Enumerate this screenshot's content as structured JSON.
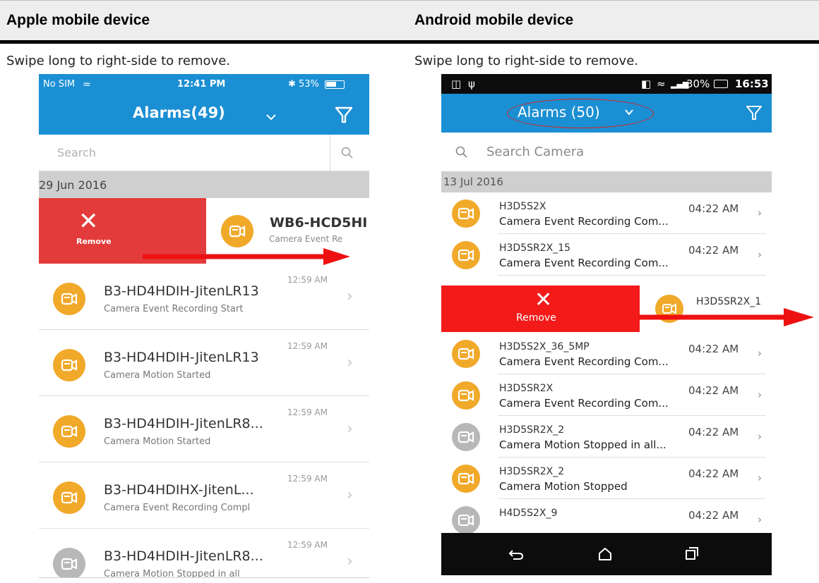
{
  "headers": {
    "left": "Apple mobile device",
    "right": "Android mobile device"
  },
  "instructions": {
    "left": "Swipe long to right-side to remove.",
    "right": "Swipe long to right-side to remove."
  },
  "ios": {
    "status": {
      "carrier": "No SIM",
      "time": "12:41 PM",
      "battery": "53%"
    },
    "title": "Alarms(49)",
    "search_placeholder": "Search",
    "date": "29 Jun 2016",
    "remove_label": "Remove",
    "swiped_item": {
      "title": "WB6-HCD5HI",
      "subtitle": "Camera Event Re"
    },
    "items": [
      {
        "title": "B3-HD4HDIH-JitenLR13",
        "subtitle": "Camera Event Recording Start",
        "time": "12:59 AM",
        "icon_color": "#f1a92a"
      },
      {
        "title": "B3-HD4HDIH-JitenLR13",
        "subtitle": "Camera Motion Started",
        "time": "12:59 AM",
        "icon_color": "#f1a92a"
      },
      {
        "title": "B3-HD4HDIH-JitenLR8...",
        "subtitle": "Camera Motion Started",
        "time": "12:59 AM",
        "icon_color": "#f1a92a"
      },
      {
        "title": "B3-HD4HDIHX-JitenL...",
        "subtitle": "Camera Event Recording Compl",
        "time": "12:59 AM",
        "icon_color": "#f1a92a"
      },
      {
        "title": "B3-HD4HDIH-JitenLR8...",
        "subtitle": "Camera Motion Stopped in all",
        "time": "12:59 AM",
        "icon_color": "#b8b8b8"
      }
    ]
  },
  "android": {
    "status": {
      "signal": "30%",
      "time": "16:53"
    },
    "title": "Alarms (50)",
    "search_placeholder": "Search Camera",
    "date": "13 Jul 2016",
    "remove_label": "Remove",
    "swiped_item": {
      "title": "H3D5SR2X_1"
    },
    "items": [
      {
        "title": "H3D5S2X",
        "subtitle": "Camera Event Recording Com...",
        "time": "04:22 AM",
        "icon_color": "#f1a92a"
      },
      {
        "title": "H3D5SR2X_15",
        "subtitle": "Camera Event Recording Com...",
        "time": "04:22 AM",
        "icon_color": "#f1a92a"
      },
      {
        "title": "H3D5S2X_36_5MP",
        "subtitle": "Camera Event Recording Com...",
        "time": "04:22 AM",
        "icon_color": "#f1a92a"
      },
      {
        "title": "H3D5SR2X",
        "subtitle": "Camera Event Recording Com...",
        "time": "04:22 AM",
        "icon_color": "#f1a92a"
      },
      {
        "title": "H3D5SR2X_2",
        "subtitle": "Camera Motion Stopped in all...",
        "time": "04:22 AM",
        "icon_color": "#b8b8b8"
      },
      {
        "title": "H3D5SR2X_2",
        "subtitle": "Camera Motion Stopped",
        "time": "04:22 AM",
        "icon_color": "#f1a92a"
      },
      {
        "title": "H4D5S2X_9",
        "subtitle": "",
        "time": "04:22 AM",
        "icon_color": "#b8b8b8"
      }
    ]
  },
  "colors": {
    "accent_blue": "#1b8fd3",
    "remove_red": "#e33b3b",
    "arrow_red": "#ee1111"
  }
}
